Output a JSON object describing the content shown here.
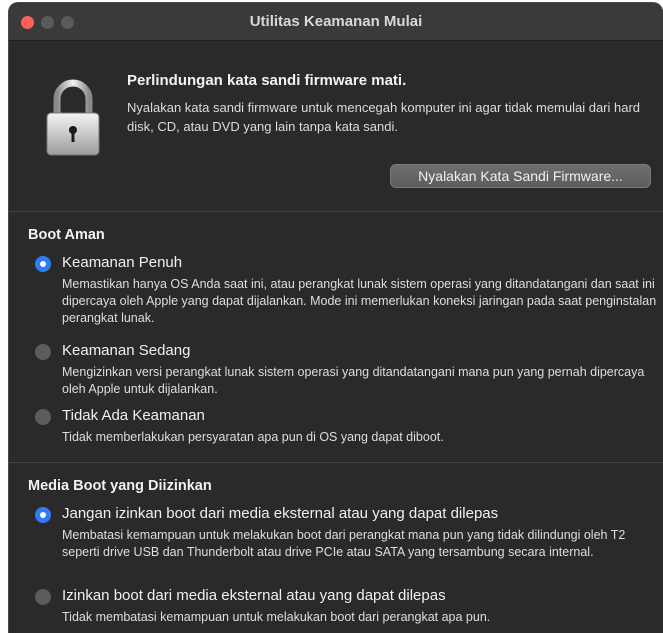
{
  "window": {
    "title": "Utilitas Keamanan Mulai"
  },
  "firmware": {
    "heading": "Perlindungan kata sandi firmware mati.",
    "description": "Nyalakan kata sandi firmware untuk mencegah komputer ini agar tidak memulai dari hard disk, CD, atau DVD yang lain tanpa kata sandi.",
    "button_label": "Nyalakan Kata Sandi Firmware..."
  },
  "secure_boot": {
    "heading": "Boot Aman",
    "options": [
      {
        "label": "Keamanan Penuh",
        "description": "Memastikan hanya OS Anda saat ini, atau perangkat lunak sistem operasi yang ditandatangani dan saat ini dipercaya oleh Apple yang dapat dijalankan. Mode ini memerlukan koneksi jaringan pada saat penginstalan perangkat lunak.",
        "selected": true
      },
      {
        "label": "Keamanan Sedang",
        "description": "Mengizinkan versi perangkat lunak sistem operasi yang ditandatangani mana pun yang pernah dipercaya oleh Apple untuk dijalankan.",
        "selected": false
      },
      {
        "label": "Tidak Ada Keamanan",
        "description": "Tidak memberlakukan persyaratan apa pun di OS yang dapat diboot.",
        "selected": false
      }
    ]
  },
  "boot_media": {
    "heading": "Media Boot yang Diizinkan",
    "options": [
      {
        "label": "Jangan izinkan boot dari media eksternal atau yang dapat dilepas",
        "description": "Membatasi kemampuan untuk melakukan boot dari perangkat mana pun yang tidak dilindungi oleh T2 seperti drive USB dan Thunderbolt atau drive PCIe atau SATA yang tersambung secara internal.",
        "selected": true
      },
      {
        "label": "Izinkan boot dari media eksternal atau yang dapat dilepas",
        "description": "Tidak membatasi kemampuan untuk melakukan boot dari perangkat apa pun.",
        "selected": false
      }
    ]
  },
  "icons": {
    "window_controls": [
      "close-icon",
      "minimize-icon",
      "zoom-icon"
    ],
    "lock": "padlock-icon"
  },
  "colors": {
    "window_bg": "#2a2a2a",
    "close_button": "#ff5f57",
    "radio_selected": "#2f7df6",
    "radio_unselected": "#5c5c5c"
  }
}
